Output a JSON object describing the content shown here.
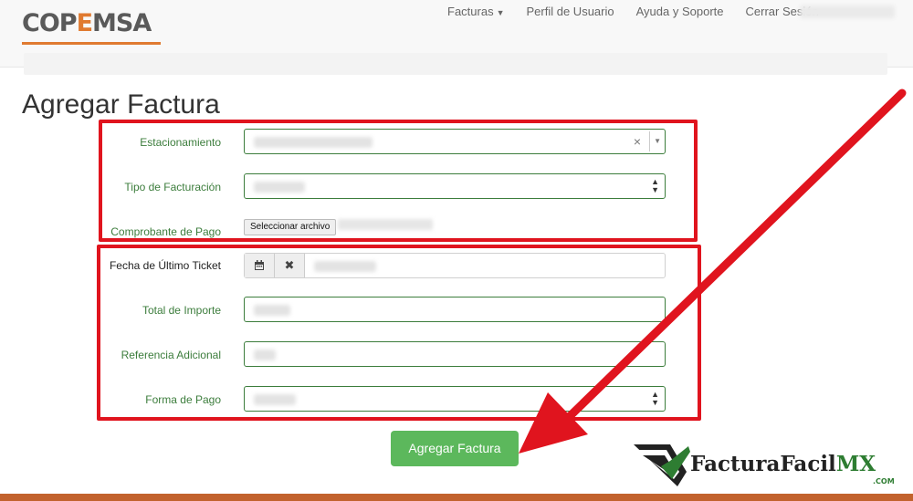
{
  "logo": {
    "text_pre": "COP",
    "text_e": "E",
    "text_post": "MSA"
  },
  "nav": {
    "facturas": "Facturas",
    "perfil": "Perfil de Usuario",
    "ayuda": "Ayuda y Soporte",
    "cerrar": "Cerrar Sesión"
  },
  "page_title": "Agregar Factura",
  "form": {
    "estacionamiento_label": "Estacionamiento",
    "tipo_label": "Tipo de Facturación",
    "comprobante_label": "Comprobante de Pago",
    "file_button": "Seleccionar archivo",
    "fecha_label": "Fecha de Último Ticket",
    "total_label": "Total de Importe",
    "referencia_label": "Referencia Adicional",
    "forma_label": "Forma de Pago",
    "submit_label": "Agregar Factura"
  },
  "icons": {
    "calendar": "calendar-icon",
    "clear": "times-icon",
    "select_clear": "×",
    "select_arrow": "▼",
    "spin": "▲▼"
  },
  "colors": {
    "accent_orange": "#e07a30",
    "label_green": "#3c7d3c",
    "submit_green": "#5cb85c",
    "annotation_red": "#e0141e"
  },
  "brand": {
    "name": "FacturaFacil",
    "suffix": "MX",
    "domain": ".COM"
  }
}
